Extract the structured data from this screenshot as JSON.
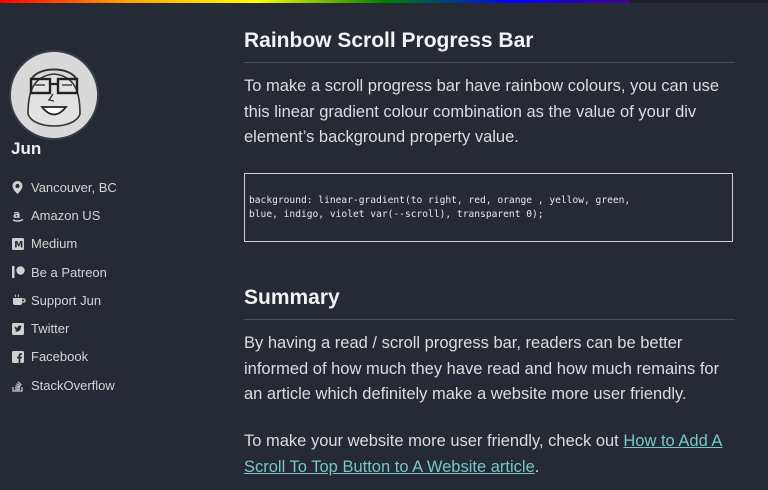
{
  "progress": {
    "fraction": 0.82
  },
  "sidebar": {
    "author_name": "Jun",
    "links": [
      {
        "label": "Vancouver, BC",
        "icon": "location-pin-icon"
      },
      {
        "label": "Amazon US",
        "icon": "amazon-icon"
      },
      {
        "label": "Medium",
        "icon": "medium-icon"
      },
      {
        "label": "Be a Patreon",
        "icon": "patreon-icon"
      },
      {
        "label": "Support Jun",
        "icon": "coffee-icon"
      },
      {
        "label": "Twitter",
        "icon": "twitter-icon"
      },
      {
        "label": "Facebook",
        "icon": "facebook-icon"
      },
      {
        "label": "StackOverflow",
        "icon": "stackoverflow-icon"
      }
    ]
  },
  "article": {
    "heading1": "Rainbow Scroll Progress Bar",
    "paragraph1": "To make a scroll progress bar have rainbow colours, you can use this linear gradient colour combination as the value of your div element’s background property value.",
    "code": "background: linear-gradient(to right, red, orange , yellow, green,\nblue, indigo, violet var(--scroll), transparent 0);",
    "heading2": "Summary",
    "paragraph2": "By having a read / scroll progress bar, readers can be better informed of how much they have read and how much remains for an article which definitely make a website more user friendly.",
    "paragraph3_prefix": "To make your website more user friendly, check out ",
    "paragraph3_link": "How to Add A Scroll To Top Button to A Website article",
    "paragraph3_suffix": "."
  },
  "colors": {
    "background": "#252a34",
    "link": "#79c6c9",
    "progress_gradient": [
      "red",
      "orange",
      "yellow",
      "green",
      "blue",
      "indigo",
      "violet"
    ]
  }
}
